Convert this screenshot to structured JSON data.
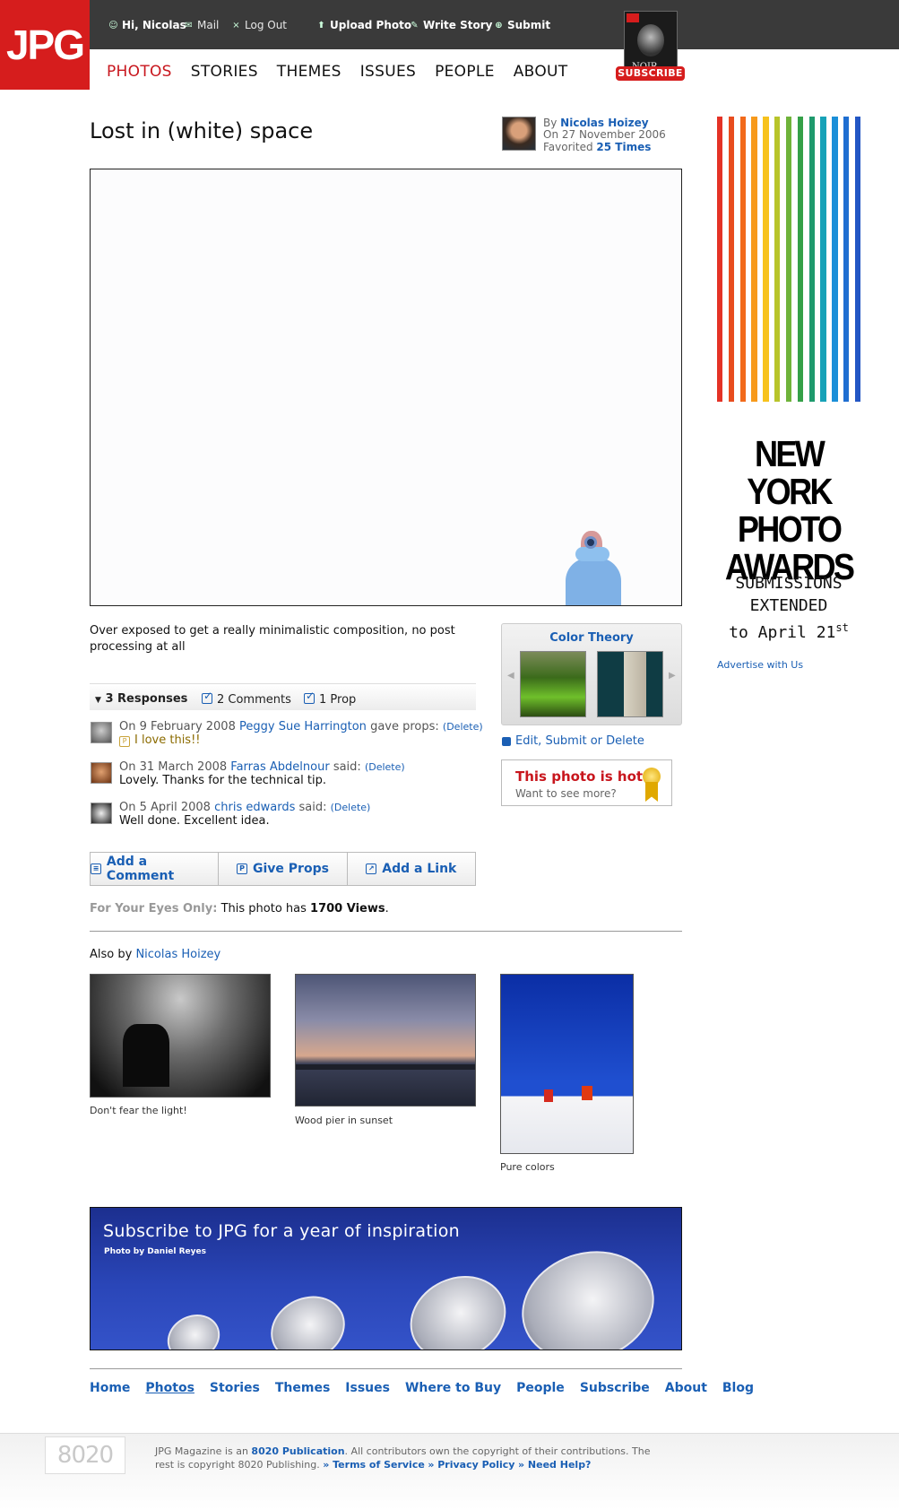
{
  "header": {
    "logo": "JPG",
    "greeting": "Hi, Nicolas",
    "mail": "Mail",
    "logout": "Log Out",
    "upload": "Upload Photo",
    "write": "Write Story",
    "submit": "Submit",
    "subscribe_badge": "SUBSCRIBE",
    "cover_text": "NOIR"
  },
  "nav": [
    "PHOTOS",
    "STORIES",
    "THEMES",
    "ISSUES",
    "PEOPLE",
    "ABOUT"
  ],
  "photo": {
    "title": "Lost in (white) space",
    "by_label": "By",
    "author": "Nicolas Hoizey",
    "on_label": "On",
    "date": "27 November 2006",
    "favorited_label": "Favorited",
    "favorited_count": "25 Times",
    "description": "Over exposed to get a really minimalistic composition, no post processing at all"
  },
  "responses": {
    "summary": "3 Responses",
    "comments": "2 Comments",
    "props": "1 Prop",
    "items": [
      {
        "on": "On",
        "date": "9 February 2008",
        "name": "Peggy Sue Harrington",
        "verb": "gave props:",
        "delete": "(Delete)",
        "body": "I love this!!"
      },
      {
        "on": "On",
        "date": "31 March 2008",
        "name": "Farras Abdelnour",
        "verb": "said:",
        "delete": "(Delete)",
        "body": "Lovely. Thanks for the technical tip."
      },
      {
        "on": "On",
        "date": "5 April 2008",
        "name": "chris edwards",
        "verb": "said:",
        "delete": "(Delete)",
        "body": "Well done. Excellent idea."
      }
    ]
  },
  "actions": {
    "add_comment": "Add a Comment",
    "give_props": "Give Props",
    "add_link": "Add a Link"
  },
  "views": {
    "label": "For Your Eyes Only:",
    "text_before": "This photo has",
    "count": "1700 Views",
    "text_after": "."
  },
  "sidebar": {
    "color_theory": "Color Theory",
    "edit": "Edit, Submit or Delete",
    "hot_title": "This photo is hot!",
    "hot_sub": "Want to see more?"
  },
  "also_by": {
    "label": "Also by",
    "author": "Nicolas Hoizey",
    "items": [
      {
        "caption": "Don't fear the light!"
      },
      {
        "caption": "Wood pier in sunset"
      },
      {
        "caption": "Pure colors"
      }
    ]
  },
  "banner": {
    "title": "Subscribe to JPG for a year of inspiration",
    "credit": "Photo by Daniel Reyes"
  },
  "footer_nav": [
    "Home",
    "Photos",
    "Stories",
    "Themes",
    "Issues",
    "Where to Buy",
    "People",
    "Subscribe",
    "About",
    "Blog"
  ],
  "footer": {
    "logo": "8020",
    "text1": "JPG Magazine is an",
    "link1": "8020 Publication",
    "text2": ". All contributors own the copyright of their contributions. The rest is copyright 8020 Publishing.",
    "terms": "» Terms of Service",
    "privacy": "» Privacy Policy",
    "help": "» Need Help?"
  },
  "ad": {
    "title_line1": "NEW YORK",
    "title_line2": "PHOTO",
    "title_line3": "AWARDS",
    "sub_line1": "SUBMISSIONS",
    "sub_line2": "EXTENDED",
    "sub_line3": "to April 21",
    "sub_sup": "st",
    "advertise": "Advertise with Us"
  }
}
